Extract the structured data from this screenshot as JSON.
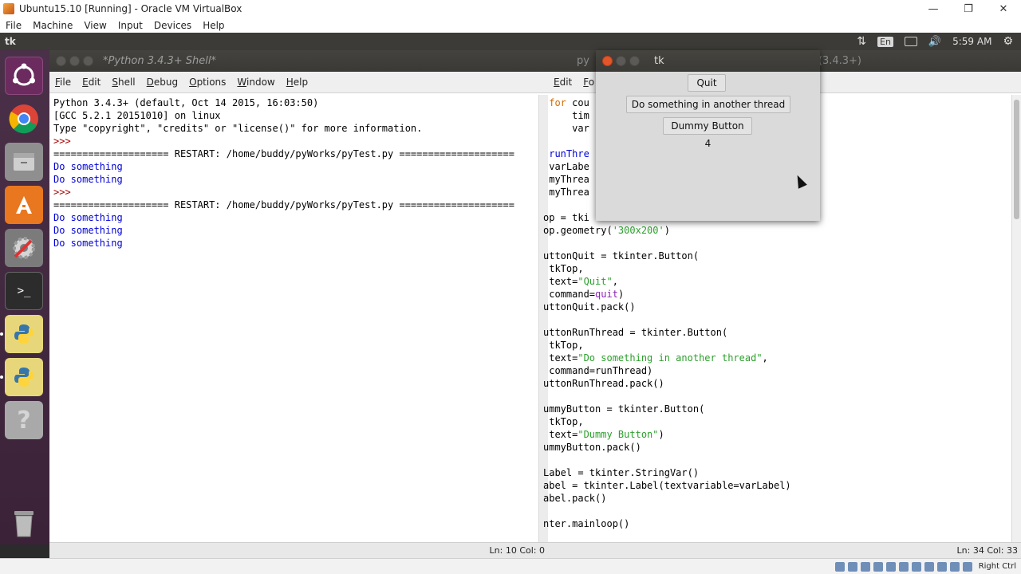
{
  "vbox": {
    "title": "Ubuntu15.10 [Running] - Oracle VM VirtualBox",
    "menu": [
      "File",
      "Machine",
      "View",
      "Input",
      "Devices",
      "Help"
    ],
    "status_host_key": "Right Ctrl"
  },
  "panel": {
    "app_title": "tk",
    "keyboard_label": "En",
    "time": "5:59 AM"
  },
  "launcher": {
    "items": [
      "ubuntu-dash",
      "chrome",
      "files",
      "software-center",
      "settings",
      "terminal",
      "python-idle-1",
      "python-idle-2",
      "help"
    ]
  },
  "shell": {
    "title": "*Python 3.4.3+ Shell*",
    "menu": [
      "File",
      "Edit",
      "Shell",
      "Debug",
      "Options",
      "Window",
      "Help"
    ],
    "lines": [
      {
        "text": "Python 3.4.3+ (default, Oct 14 2015, 16:03:50)",
        "cls": ""
      },
      {
        "text": "[GCC 5.2.1 20151010] on linux",
        "cls": ""
      },
      {
        "text": "Type \"copyright\", \"credits\" or \"license()\" for more information.",
        "cls": ""
      },
      {
        "text": ">>> ",
        "cls": "sl-red"
      },
      {
        "text": "==================== RESTART: /home/buddy/pyWorks/pyTest.py ====================",
        "cls": ""
      },
      {
        "text": "Do something",
        "cls": "sl-blue"
      },
      {
        "text": "Do something",
        "cls": "sl-blue"
      },
      {
        "text": ">>> ",
        "cls": "sl-red"
      },
      {
        "text": "==================== RESTART: /home/buddy/pyWorks/pyTest.py ====================",
        "cls": ""
      },
      {
        "text": "Do something",
        "cls": "sl-blue"
      },
      {
        "text": "Do something",
        "cls": "sl-blue"
      },
      {
        "text": "Do something",
        "cls": "sl-blue"
      }
    ],
    "status": "Ln: 10 Col: 0"
  },
  "editor": {
    "title": "py",
    "title_right": "(3.4.3+)",
    "menu": [
      "Edit",
      "Fo"
    ],
    "status": "Ln: 34 Col: 33",
    "code_lines": [
      [
        {
          "t": " "
        },
        {
          "t": "for",
          "c": "kw"
        },
        {
          "t": " cou"
        }
      ],
      [
        {
          "t": "     tim"
        }
      ],
      [
        {
          "t": "     var"
        }
      ],
      [
        {
          "t": ""
        }
      ],
      [
        {
          "t": " "
        },
        {
          "t": "runThre",
          "c": "df"
        }
      ],
      [
        {
          "t": " varLabe"
        }
      ],
      [
        {
          "t": " myThrea"
        }
      ],
      [
        {
          "t": " myThrea"
        }
      ],
      [
        {
          "t": ""
        }
      ],
      [
        {
          "t": "op = tki"
        }
      ],
      [
        {
          "t": "op.geometry("
        },
        {
          "t": "'300x200'",
          "c": "st"
        },
        {
          "t": ")"
        }
      ],
      [
        {
          "t": ""
        }
      ],
      [
        {
          "t": "uttonQuit = tkinter.Button("
        }
      ],
      [
        {
          "t": " tkTop,"
        }
      ],
      [
        {
          "t": " text="
        },
        {
          "t": "\"Quit\"",
          "c": "st"
        },
        {
          "t": ","
        }
      ],
      [
        {
          "t": " command="
        },
        {
          "t": "quit",
          "c": "bi"
        },
        {
          "t": ")"
        }
      ],
      [
        {
          "t": "uttonQuit.pack()"
        }
      ],
      [
        {
          "t": ""
        }
      ],
      [
        {
          "t": "uttonRunThread = tkinter.Button("
        }
      ],
      [
        {
          "t": " tkTop,"
        }
      ],
      [
        {
          "t": " text="
        },
        {
          "t": "\"Do something in another thread\"",
          "c": "st"
        },
        {
          "t": ","
        }
      ],
      [
        {
          "t": " command=runThread)"
        }
      ],
      [
        {
          "t": "uttonRunThread.pack()"
        }
      ],
      [
        {
          "t": ""
        }
      ],
      [
        {
          "t": "ummyButton = tkinter.Button("
        }
      ],
      [
        {
          "t": " tkTop,"
        }
      ],
      [
        {
          "t": " text="
        },
        {
          "t": "\"Dummy Button\"",
          "c": "st"
        },
        {
          "t": ")"
        }
      ],
      [
        {
          "t": "ummyButton.pack()"
        }
      ],
      [
        {
          "t": ""
        }
      ],
      [
        {
          "t": "Label = tkinter.StringVar()"
        }
      ],
      [
        {
          "t": "abel = tkinter.Label(textvariable=varLabel)"
        }
      ],
      [
        {
          "t": "abel.pack()"
        }
      ],
      [
        {
          "t": ""
        }
      ],
      [
        {
          "t": "nter.mainloop()"
        }
      ]
    ]
  },
  "tk": {
    "title": "tk",
    "quit_label": "Quit",
    "run_thread_label": "Do something in another thread",
    "dummy_label": "Dummy Button",
    "counter": "4"
  }
}
